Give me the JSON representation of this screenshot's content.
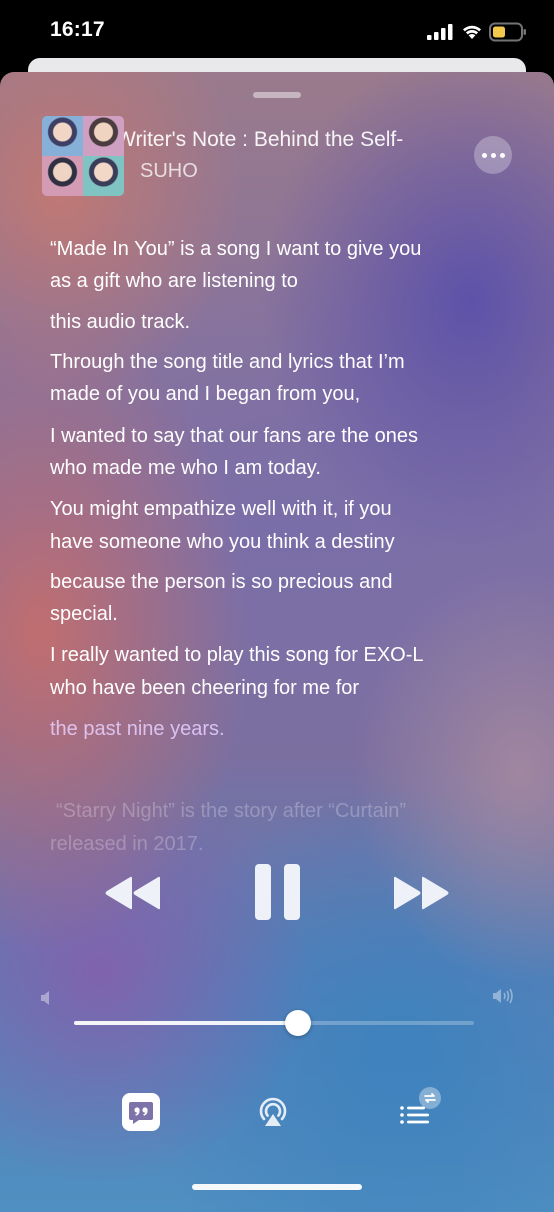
{
  "status_bar": {
    "time": "16:17"
  },
  "now_playing": {
    "title": "Writer's Note : Behind the Self-",
    "artist": "SUHO"
  },
  "lyrics": [
    "“Made In You” is a song I want to give you",
    "as a gift who are listening to",
    "this audio track.",
    " Through the song title and lyrics that I’m",
    "made of you and I began from you,",
    "I wanted to say that our fans are the ones",
    "who made me who I am today.",
    " You might empathize well with it, if you",
    "have someone who you think a destiny",
    "because the person is so precious and",
    "special.",
    " I really wanted to play this song for EXO-L",
    "who have been cheering for me for",
    "the past nine years.",
    "“Starry Night” is the story after “Curtain”",
    "released in 2017."
  ],
  "volume": {
    "level": 0.56
  },
  "colors": {
    "accent": "#ffffff",
    "background_top": "#9a7a8c",
    "background_bottom": "#4f8fc1"
  },
  "icons": {
    "more": "ellipsis-icon",
    "rewind": "rewind-icon",
    "pause": "pause-icon",
    "forward": "fast-forward-icon",
    "lyrics": "lyrics-quote-icon",
    "airplay": "airplay-icon",
    "queue": "queue-list-icon"
  }
}
